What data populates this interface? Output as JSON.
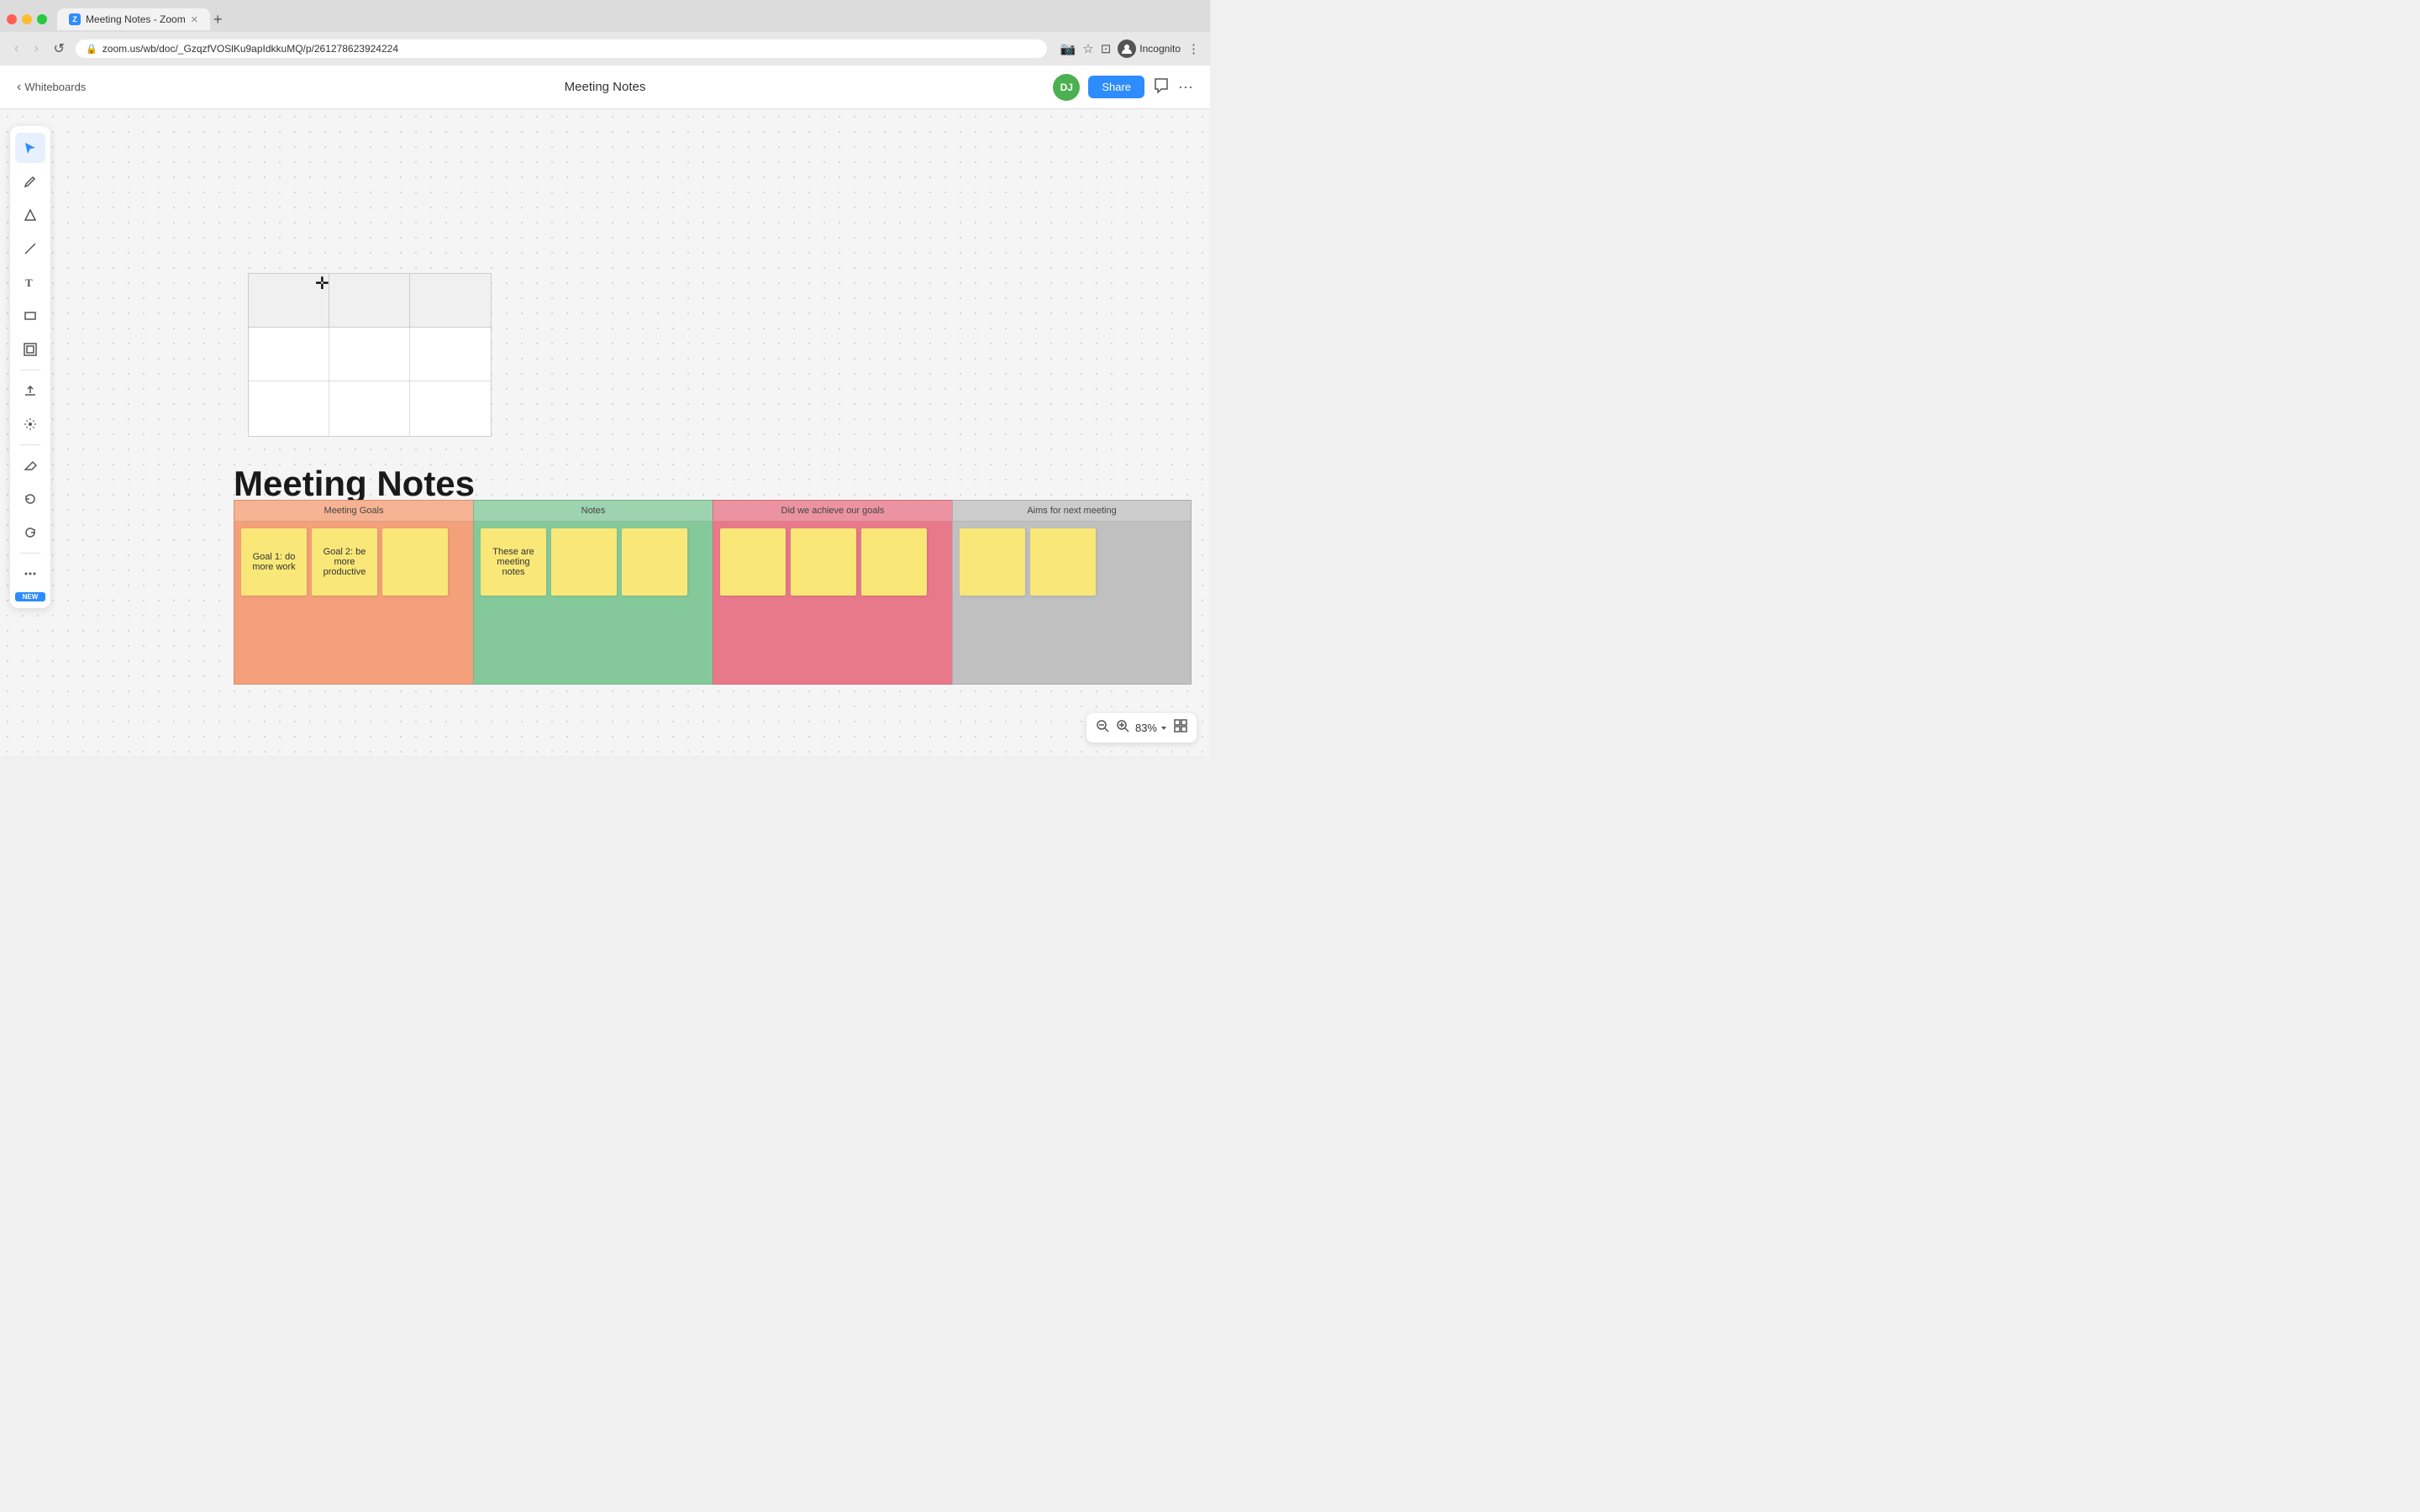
{
  "browser": {
    "tab_label": "Meeting Notes - Zoom",
    "tab_icon_text": "Z",
    "url": "zoom.us/wb/doc/_GzqzfVOSlKu9apIdkkuMQ/p/261278623924224",
    "nav_back": "‹",
    "nav_forward": "›",
    "nav_reload": "↺",
    "incognito_label": "Incognito",
    "new_tab_btn": "+"
  },
  "header": {
    "back_label": "Whiteboards",
    "title": "Meeting Notes",
    "avatar_initials": "DJ",
    "share_label": "Share",
    "comment_icon": "💬",
    "more_icon": "···"
  },
  "toolbar": {
    "tools": [
      {
        "name": "select",
        "icon": "⬆",
        "active": true
      },
      {
        "name": "draw",
        "icon": "✏"
      },
      {
        "name": "shape",
        "icon": "△"
      },
      {
        "name": "line",
        "icon": "/"
      },
      {
        "name": "text",
        "icon": "T"
      },
      {
        "name": "rect",
        "icon": "□"
      },
      {
        "name": "frame",
        "icon": "▣"
      },
      {
        "name": "upload",
        "icon": "⬆"
      },
      {
        "name": "ai",
        "icon": "✦"
      },
      {
        "name": "eraser",
        "icon": "◇"
      },
      {
        "name": "undo",
        "icon": "↩"
      },
      {
        "name": "redo",
        "icon": "↪"
      },
      {
        "name": "grid",
        "icon": "⋯"
      }
    ],
    "new_badge": "NEW"
  },
  "canvas": {
    "title": "Meeting Notes"
  },
  "board_sections": [
    {
      "id": "meeting-goals",
      "label": "Meeting Goals",
      "color": "#f9c0a0",
      "cards": [
        {
          "text": "Goal 1: do more work"
        },
        {
          "text": "Goal 2: be more productive"
        },
        {
          "text": ""
        }
      ]
    },
    {
      "id": "notes",
      "label": "Notes",
      "color": "#a8d8b0",
      "cards": [
        {
          "text": "These are meeting notes"
        },
        {
          "text": ""
        },
        {
          "text": ""
        }
      ]
    },
    {
      "id": "did-we-achieve",
      "label": "Did we achieve our goals",
      "color": "#f9a0b0",
      "cards": [
        {
          "text": ""
        },
        {
          "text": ""
        },
        {
          "text": ""
        }
      ]
    },
    {
      "id": "aims-next",
      "label": "Aims for next meeting",
      "color": "#d0d0d0",
      "cards": [
        {
          "text": ""
        },
        {
          "text": ""
        }
      ]
    }
  ],
  "zoom": {
    "level": "83%",
    "zoom_in_icon": "⊕",
    "zoom_out_icon": "⊖",
    "grid_icon": "⊞"
  }
}
